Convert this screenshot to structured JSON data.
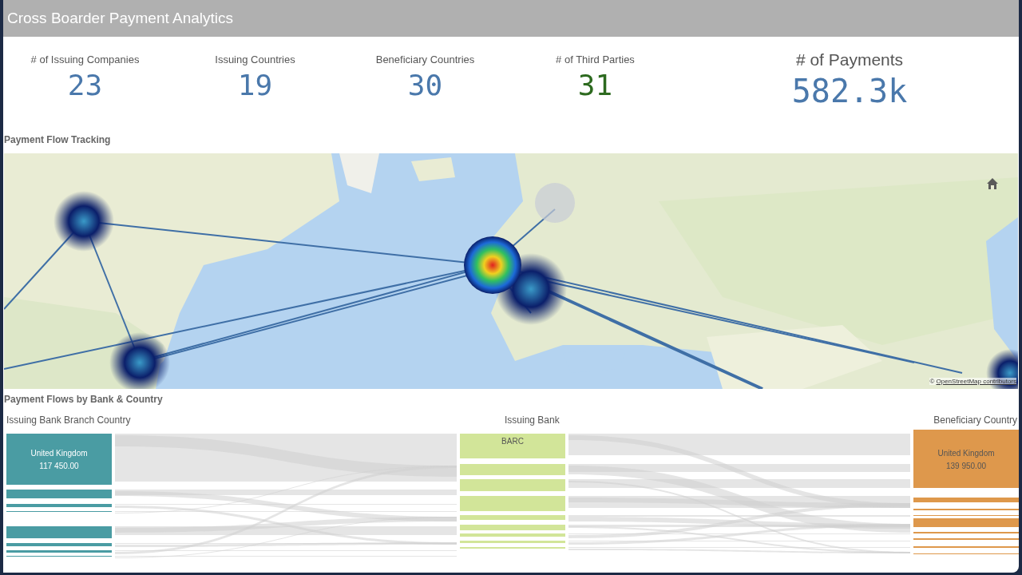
{
  "header": {
    "title": "Cross Boarder Payment Analytics"
  },
  "kpis": [
    {
      "label": "# of Issuing Companies",
      "value": "23",
      "color": "#4a78ab",
      "kind": "small"
    },
    {
      "label": "Issuing Countries",
      "value": "19",
      "color": "#4a78ab",
      "kind": "small"
    },
    {
      "label": "Beneficiary Countries",
      "value": "30",
      "color": "#4a78ab",
      "kind": "small"
    },
    {
      "label": "# of Third Parties",
      "value": "31",
      "color": "#2d6a1f",
      "kind": "small"
    },
    {
      "label": "# of Payments",
      "value": "582.3k",
      "color": "#4a78ab",
      "kind": "large"
    }
  ],
  "map_section": {
    "title": "Payment Flow Tracking",
    "attribution": {
      "prefix": "©",
      "link": "OpenStreetMap contributors"
    }
  },
  "flow_section": {
    "title": "Payment Flows by Bank & Country",
    "columns": [
      {
        "heading": "Issuing Bank Branch Country",
        "color": "#4a9ca3",
        "node": {
          "label": "United Kingdom",
          "value": "117 450.00"
        }
      },
      {
        "heading": "Issuing Bank",
        "color": "#d2e599",
        "node": {
          "label": "BARC"
        }
      },
      {
        "heading": "Beneficiary Country",
        "color": "#de984c",
        "node": {
          "label": "United Kingdom",
          "value": "139 950.00"
        }
      }
    ]
  }
}
